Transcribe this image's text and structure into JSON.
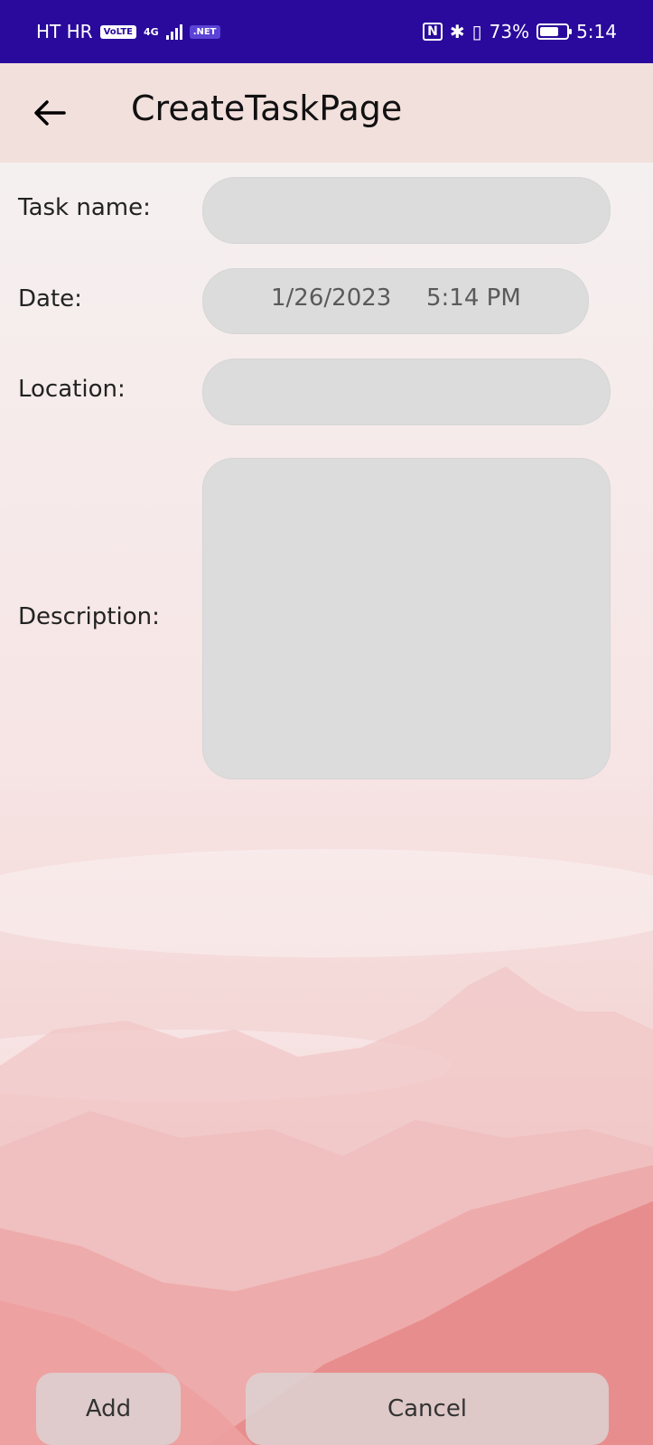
{
  "status_bar": {
    "carrier": "HT HR",
    "volte": "VoLTE",
    "network": "4G",
    "net_badge": ".NET",
    "battery_percent": "73%",
    "time": "5:14",
    "battery_level": 0.73
  },
  "app_bar": {
    "title": "CreateTaskPage",
    "back_icon": "arrow-left-icon"
  },
  "form": {
    "task_name": {
      "label": "Task name:",
      "value": ""
    },
    "date": {
      "label": "Date:",
      "date_value": "1/26/2023",
      "time_value": "5:14 PM"
    },
    "location": {
      "label": "Location:",
      "value": ""
    },
    "description": {
      "label": "Description:",
      "value": ""
    }
  },
  "actions": {
    "add_label": "Add",
    "cancel_label": "Cancel"
  },
  "colors": {
    "status_bar": "#2a0a9c",
    "app_bar": "#f2e0dd",
    "field": "#dcdcdc",
    "mountain": "#e88d8d"
  }
}
